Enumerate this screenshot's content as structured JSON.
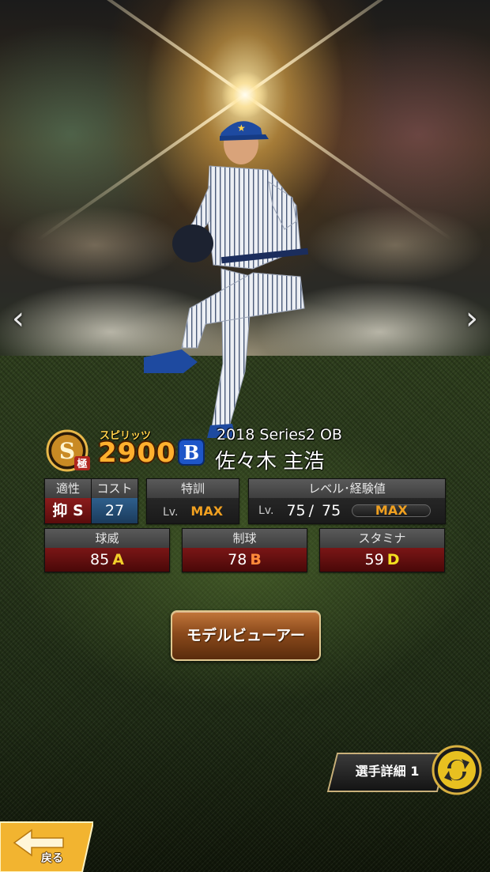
{
  "player": {
    "series": "2018 Series2 OB",
    "name": "佐々木 主浩",
    "team_logo_letter": "B",
    "rank": "S",
    "rank_sub": "極"
  },
  "spirits": {
    "label": "スピリッツ",
    "value": "2900"
  },
  "panels": {
    "aptitude": {
      "header": "適性",
      "value": "抑 S"
    },
    "cost": {
      "header": "コスト",
      "value": "27"
    },
    "training": {
      "header": "特訓",
      "lv_prefix": "Lv.",
      "value": "MAX"
    },
    "level": {
      "header": "レベル･経験値",
      "lv_prefix": "Lv.",
      "current": "75",
      "separator": "/",
      "max": "75",
      "exp_text": "MAX",
      "exp_fill": 1.0
    }
  },
  "stats": {
    "velocity": {
      "label": "球威",
      "value": "85",
      "grade": "A",
      "grade_color": "#f2cf2a"
    },
    "control": {
      "label": "制球",
      "value": "78",
      "grade": "B",
      "grade_color": "#ff8a3a"
    },
    "stamina": {
      "label": "スタミナ",
      "value": "59",
      "grade": "D",
      "grade_color": "#f2e020"
    }
  },
  "buttons": {
    "model_viewer": "モデルビューアー",
    "player_detail": "選手詳細 1",
    "back": "戻る"
  },
  "nav": {
    "prev_glyph": "‹",
    "next_glyph": "›"
  },
  "colors": {
    "spirits_gold": "#ffb02e",
    "team_blue": "#1e56c8",
    "max_orange": "#f0a020"
  }
}
